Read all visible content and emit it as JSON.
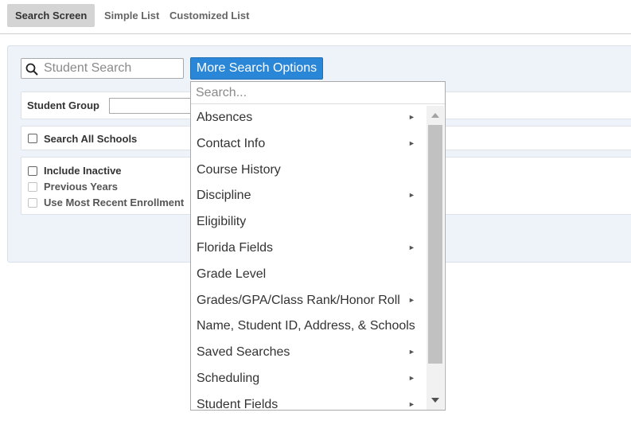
{
  "tabs": [
    {
      "label": "Search Screen",
      "active": true
    },
    {
      "label": "Simple List",
      "active": false
    },
    {
      "label": "Customized List",
      "active": false
    }
  ],
  "search": {
    "placeholder": "Student Search",
    "value": ""
  },
  "more_button": {
    "label": "More Search Options"
  },
  "student_group": {
    "label": "Student Group",
    "value": ""
  },
  "search_all_schools": {
    "label": "Search All Schools",
    "checked": false
  },
  "options": {
    "include_inactive": {
      "label": "Include Inactive",
      "checked": false
    },
    "previous_years": {
      "label": "Previous Years",
      "checked": false,
      "disabled": true
    },
    "most_recent": {
      "label": "Use Most Recent Enrollment",
      "checked": false,
      "disabled": true
    }
  },
  "dropdown": {
    "search_placeholder": "Search...",
    "items": [
      {
        "label": "Absences",
        "submenu": true
      },
      {
        "label": "Contact Info",
        "submenu": true
      },
      {
        "label": "Course History",
        "submenu": false
      },
      {
        "label": "Discipline",
        "submenu": true
      },
      {
        "label": "Eligibility",
        "submenu": false
      },
      {
        "label": "Florida Fields",
        "submenu": true
      },
      {
        "label": "Grade Level",
        "submenu": false
      },
      {
        "label": "Grades/GPA/Class Rank/Honor Roll",
        "submenu": true
      },
      {
        "label": "Name, Student ID, Address, & Schools",
        "submenu": false
      },
      {
        "label": "Saved Searches",
        "submenu": true
      },
      {
        "label": "Scheduling",
        "submenu": true
      },
      {
        "label": "Student Fields",
        "submenu": true
      }
    ]
  },
  "colors": {
    "accent": "#2a86d6",
    "panel_bg": "#eef2f9",
    "active_tab_bg": "#d4d4d4"
  }
}
